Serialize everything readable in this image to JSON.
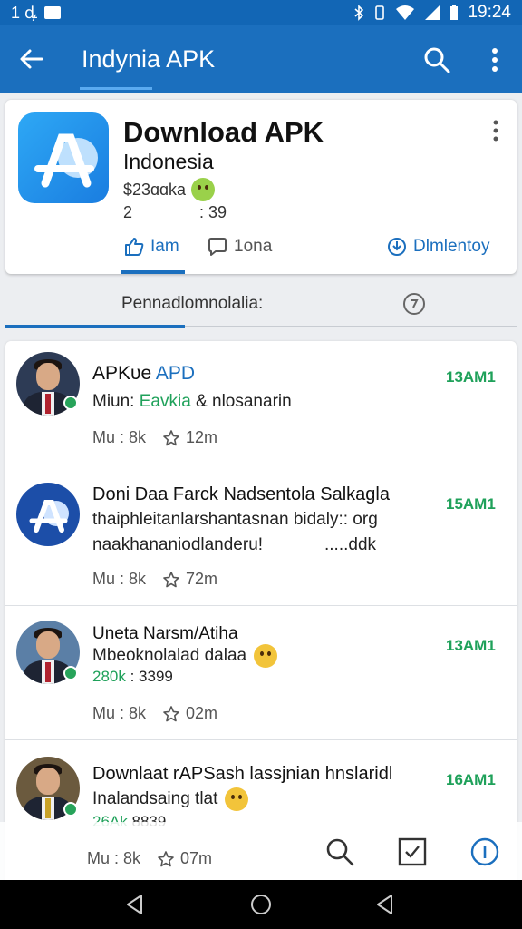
{
  "status_bar": {
    "left_text": "1 ꝱ",
    "time": "19:24"
  },
  "app_bar": {
    "title": "Indynia APK"
  },
  "header_card": {
    "title": "Download APK",
    "subtitle": "Indonesia",
    "meta": "$23ɑɑka",
    "stats_left": "2",
    "stats_right": ": 39",
    "actions": {
      "like": "Iam",
      "comment": "1ona",
      "download": "Dlmlentoy"
    }
  },
  "section": {
    "label": "Pennadlomnolalia:"
  },
  "posts": [
    {
      "title_a": "APKᴜe",
      "title_b": " APD",
      "line1_a": "Miun: ",
      "line1_b": "Eavkia",
      "line1_c": " & nlosanarin",
      "time": "13AM1",
      "stat_left": "Mu : 8k",
      "stat_right": "12m"
    },
    {
      "title": "Doni Daa Farck Nadsentola Salkagla",
      "line1": "thaiphleitanlarshantasnan bidaly:: org",
      "line2": "naakhananiodlanderu!",
      "line2_right": ".....ddk",
      "time": "15AM1",
      "stat_left": "Mu : 8k",
      "stat_right": "72m"
    },
    {
      "title": "Uneta Narsm/Atiha",
      "line1": "Mbeoknolalad dalaa",
      "line2_a": "280k",
      "line2_b": ": 3399",
      "time": "13AM1",
      "stat_left": "Mu : 8k",
      "stat_right": "02m"
    },
    {
      "title": "Downlaat rAPSash lassjnian hnslaridl",
      "line1": "Inalandsaing tlat",
      "line2_a": "26Ak",
      "line2_b": " 8839",
      "time": "16AM1",
      "stat_left": "Mu : 8k",
      "stat_right": "07m"
    }
  ],
  "colors": {
    "primary": "#1b6fbe",
    "accent_green": "#1fa15a"
  }
}
